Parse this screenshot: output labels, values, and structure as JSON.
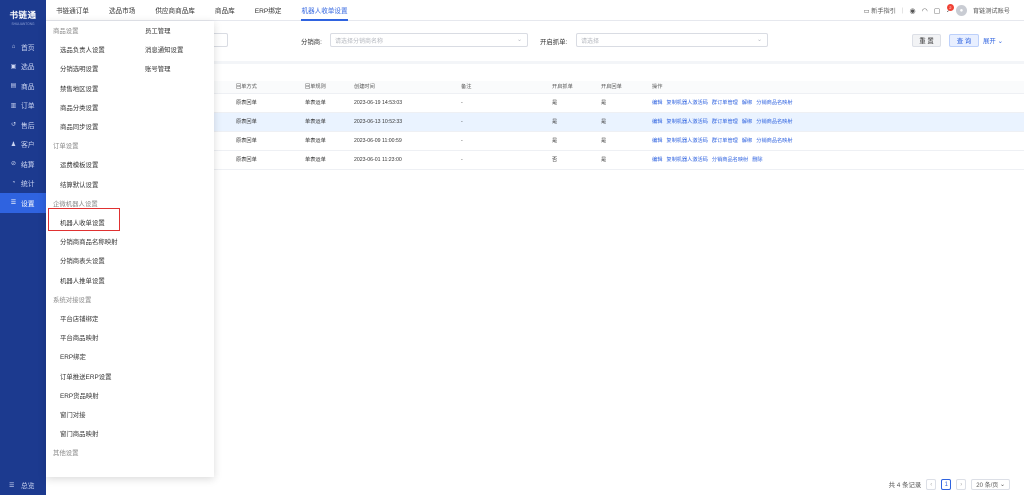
{
  "logo": {
    "title": "书链通",
    "subtitle": "SHULIANTONG"
  },
  "sidebar": {
    "items": [
      {
        "icon": "home-icon",
        "glyph": "⌂",
        "label": "首页",
        "active": false
      },
      {
        "icon": "product-icon",
        "glyph": "▣",
        "label": "选品",
        "active": false
      },
      {
        "icon": "goods-icon",
        "glyph": "▤",
        "label": "商品",
        "active": false
      },
      {
        "icon": "order-icon",
        "glyph": "▥",
        "label": "订单",
        "active": false
      },
      {
        "icon": "aftersale-icon",
        "glyph": "↺",
        "label": "售后",
        "active": false
      },
      {
        "icon": "customer-icon",
        "glyph": "♟",
        "label": "客户",
        "active": false
      },
      {
        "icon": "settlement-icon",
        "glyph": "⊘",
        "label": "结算",
        "active": false
      },
      {
        "icon": "stats-icon",
        "glyph": "◔",
        "label": "统计",
        "active": false
      },
      {
        "icon": "settings-icon",
        "glyph": "☰",
        "label": "设置",
        "active": true
      }
    ],
    "footer": {
      "icon": "menu-icon",
      "glyph": "☰",
      "label": "总览"
    }
  },
  "topbar": {
    "tabs": [
      {
        "label": "书链通订单",
        "active": false
      },
      {
        "label": "选品市场",
        "active": false
      },
      {
        "label": "供应商商品库",
        "active": false
      },
      {
        "label": "商品库",
        "active": false
      },
      {
        "label": "ERP绑定",
        "active": false
      },
      {
        "label": "机器人收单设置",
        "active": true
      }
    ],
    "guide": "新手指引",
    "notification_count": "2",
    "username": "育链测试账号"
  },
  "filter": {
    "distributor_label": "分销商:",
    "distributor_placeholder": "请选择分销商名称",
    "open_label": "开启抓单:",
    "open_placeholder": "请选择",
    "reset": "重 置",
    "query": "查 询",
    "expand": "展开"
  },
  "table": {
    "headers": [
      "名称",
      "回单时间",
      "回单方式",
      "回单规则",
      "创建时间",
      "备注",
      "开启抓单",
      "开启回单",
      "操作"
    ],
    "rows": [
      {
        "name": "采测试1234",
        "time": "18:00",
        "method": "原表回单",
        "rule": "单表运单",
        "created": "2023-06-19 14:53:03",
        "note": "-",
        "grab": "是",
        "reply": "是",
        "ops": [
          "编辑",
          "复制机器人激活码",
          "群订单管理",
          "解绑",
          "分销商品名映射"
        ]
      },
      {
        "name": "本演示",
        "time": "18:00",
        "method": "原表回单",
        "rule": "单表运单",
        "created": "2023-06-13 10:52:33",
        "note": "-",
        "grab": "是",
        "reply": "是",
        "ops": [
          "编辑",
          "复制机器人激活码",
          "群订单管理",
          "解绑",
          "分销商品名映射"
        ]
      },
      {
        "name": "品道和分销商1",
        "time": "18:00",
        "method": "原表回单",
        "rule": "单表运单",
        "created": "2023-06-09 11:00:59",
        "note": "-",
        "grab": "是",
        "reply": "是",
        "ops": [
          "编辑",
          "复制机器人激活码",
          "群订单管理",
          "解绑",
          "分销商品名映射"
        ]
      },
      {
        "name": "",
        "time": "18:00",
        "method": "原表回单",
        "rule": "单表运单",
        "created": "2023-06-01 11:23:00",
        "note": "-",
        "grab": "否",
        "reply": "是",
        "ops": [
          "编辑",
          "复制机器人激活码",
          "分销商品名映射",
          "删除"
        ]
      }
    ]
  },
  "pager": {
    "total": "共 4 条记录",
    "current": "1",
    "page_size": "20 条/页"
  },
  "menu": {
    "col1": [
      {
        "label": "商品设置",
        "group": true
      },
      {
        "label": "选品负责人设置",
        "group": false
      },
      {
        "label": "分销选明设置",
        "group": false
      },
      {
        "label": "禁售地区设置",
        "group": false
      },
      {
        "label": "商品分类设置",
        "group": false
      },
      {
        "label": "商品同步设置",
        "group": false
      },
      {
        "label": "订单设置",
        "group": true
      },
      {
        "label": "运费模板设置",
        "group": false
      },
      {
        "label": "结算默认设置",
        "group": false
      },
      {
        "label": "企微机器人设置",
        "group": true
      },
      {
        "label": "机器人收单设置",
        "group": false
      },
      {
        "label": "分销商商品名称映射",
        "group": false
      },
      {
        "label": "分销商表头设置",
        "group": false
      },
      {
        "label": "机器人推单设置",
        "group": false
      },
      {
        "label": "系统对接设置",
        "group": true
      },
      {
        "label": "平台店铺绑定",
        "group": false
      },
      {
        "label": "平台商品映射",
        "group": false
      },
      {
        "label": "ERP绑定",
        "group": false
      },
      {
        "label": "订单推送ERP设置",
        "group": false
      },
      {
        "label": "ERP货品映射",
        "group": false
      },
      {
        "label": "窗门对接",
        "group": false
      },
      {
        "label": "窗门商品映射",
        "group": false
      },
      {
        "label": "其他设置",
        "group": true
      }
    ],
    "col2": [
      {
        "label": "员工管理"
      },
      {
        "label": "消息通知设置"
      },
      {
        "label": "账号管理"
      }
    ]
  },
  "colors": {
    "sidebar": "#1c3a8f",
    "accent": "#2f63e0",
    "highlight_box": "#e03131"
  }
}
